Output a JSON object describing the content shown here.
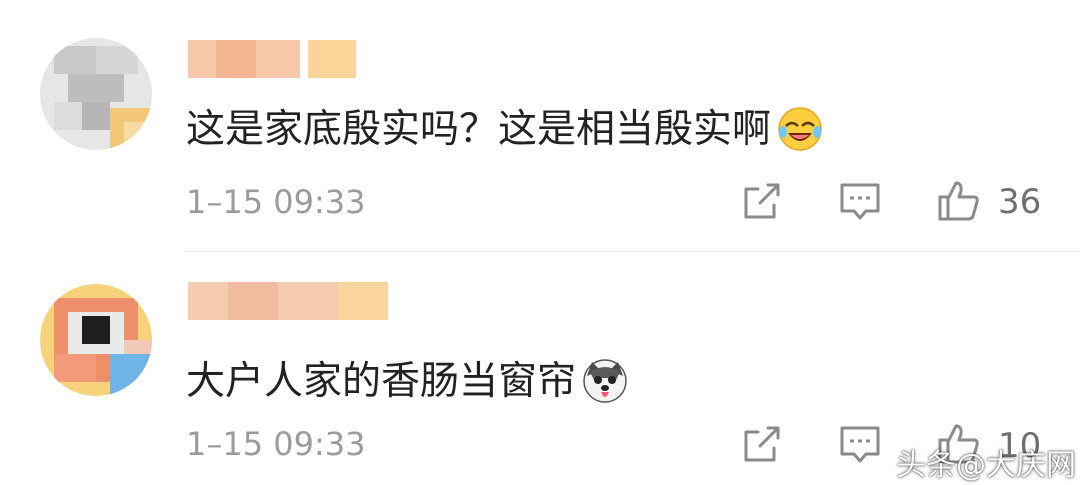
{
  "comments": [
    {
      "text": "这是家底殷实吗？这是相当殷实啊",
      "emoji_icon": "laugh-cry-emoji-icon",
      "time": "1–15 09:33",
      "likes": "36"
    },
    {
      "text": "大户人家的香肠当窗帘",
      "emoji_icon": "husky-dog-emoji-icon",
      "time": "1–15 09:33",
      "likes": "10"
    }
  ],
  "watermark": "头条@大庆网",
  "colors": {
    "text": "#222222",
    "meta": "#9b9b9b",
    "icon": "#8a8a8a",
    "username_blur": "#f7c9a8",
    "username_blur_accent": "#fbd79c"
  }
}
